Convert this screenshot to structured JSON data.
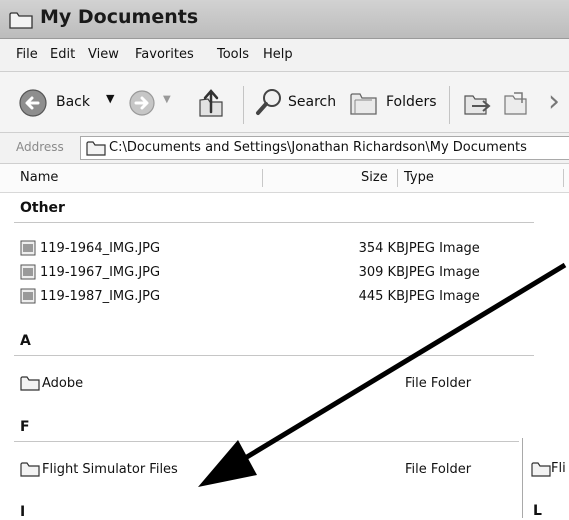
{
  "window": {
    "title": "My Documents"
  },
  "menu": [
    "File",
    "Edit",
    "View",
    "Favorites",
    "Tools",
    "Help"
  ],
  "toolbar": {
    "back_label": "Back",
    "search_label": "Search",
    "folders_label": "Folders"
  },
  "address": {
    "label": "Address",
    "path": "C:\\Documents and Settings\\Jonathan Richardson\\My Documents"
  },
  "columns": {
    "name": "Name",
    "size": "Size",
    "type": "Type"
  },
  "groups": [
    {
      "label": "Other",
      "items": [
        {
          "name": "119-1964_IMG.JPG",
          "size": "354 KB",
          "type": "JPEG Image",
          "icon": "jpeg-file-icon"
        },
        {
          "name": "119-1967_IMG.JPG",
          "size": "309 KB",
          "type": "JPEG Image",
          "icon": "jpeg-file-icon"
        },
        {
          "name": "119-1987_IMG.JPG",
          "size": "445 KB",
          "type": "JPEG Image",
          "icon": "jpeg-file-icon"
        }
      ]
    },
    {
      "label": "A",
      "items": [
        {
          "name": "Adobe",
          "size": "",
          "type": "File Folder",
          "icon": "folder-icon"
        }
      ]
    },
    {
      "label": "F",
      "items": [
        {
          "name": "Flight Simulator Files",
          "size": "",
          "type": "File Folder",
          "icon": "folder-icon"
        }
      ]
    },
    {
      "label": "I",
      "items": []
    }
  ],
  "overlay_pane": {
    "group_label": "L",
    "item_text": "Fli"
  }
}
